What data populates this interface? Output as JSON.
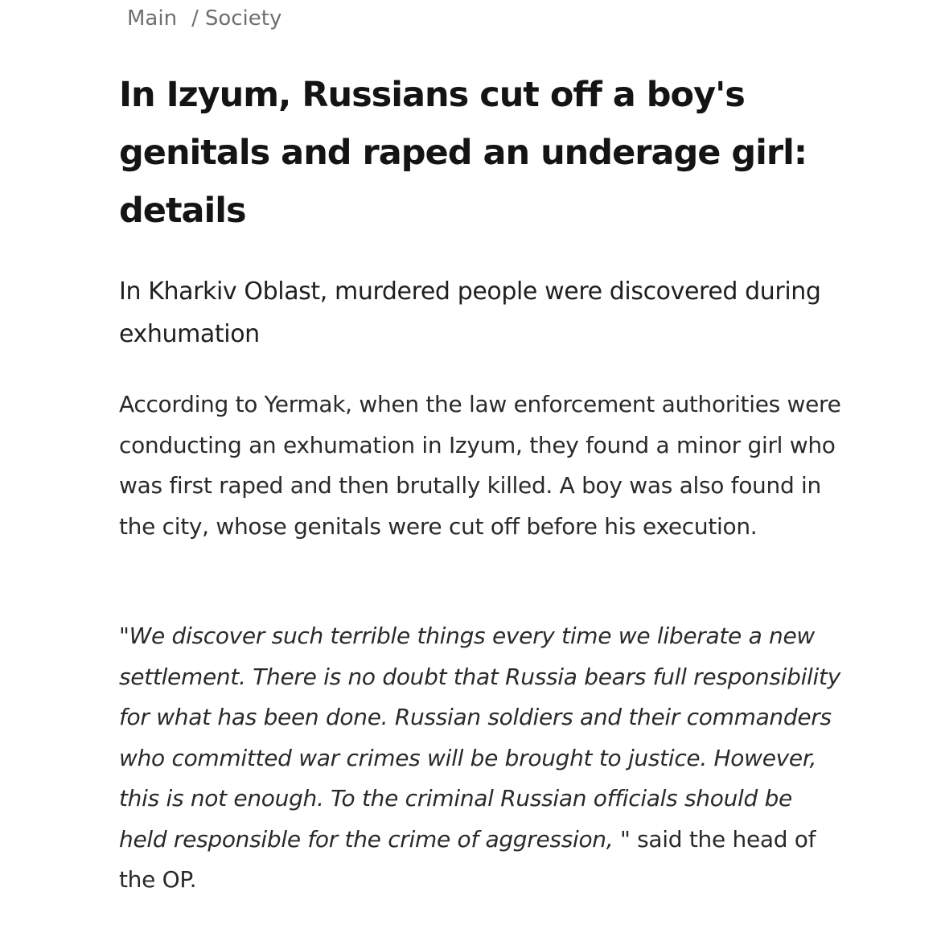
{
  "breadcrumb": {
    "home": "Main",
    "separator": "/",
    "section": "Society"
  },
  "article": {
    "headline": "In Izyum, Russians cut off a boy's genitals and raped an underage girl: details",
    "lead": "In Kharkiv Oblast, murdered people were discovered during exhumation",
    "paragraph": "According to Yermak, when the law enforcement authorities were conducting an exhumation in Izyum, they found a minor girl who was first raped and then brutally killed. A boy was also found in the city, whose genitals were cut off before his execution.",
    "quote": "\"We discover such terrible things every time we liberate a new settlement. There is no doubt that Russia bears full responsibility for what has been done. Russian soldiers and their commanders who committed war crimes will be brought to justice. However, this is not enough. To the criminal Russian officials should be held responsible for the crime of aggression, \"",
    "attribution": " said the head of the OP."
  }
}
